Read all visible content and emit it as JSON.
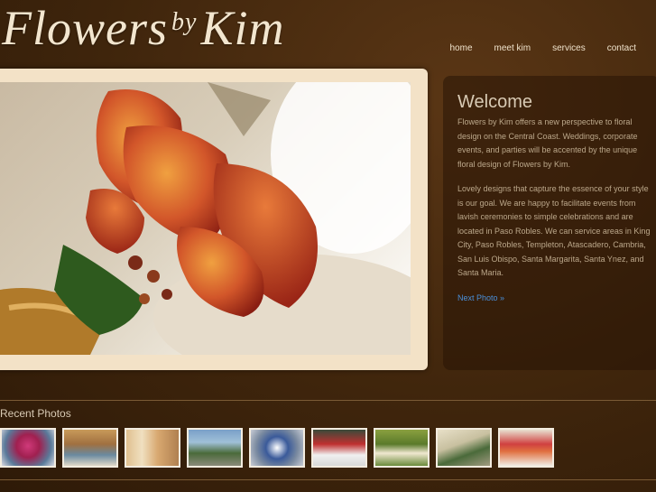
{
  "header": {
    "logo_main": "Flowers",
    "logo_by": "by",
    "logo_name": "Kim",
    "nav": [
      "home",
      "meet kim",
      "services",
      "contact"
    ]
  },
  "welcome": {
    "title": "Welcome",
    "para1": "Flowers by Kim offers a new perspective to floral design on the Central Coast. Weddings, corporate events, and parties will be accented by the unique floral design of Flowers by Kim.",
    "para2": "Lovely designs that capture the essence of your style is our goal.  We are happy to facilitate events from lavish ceremonies to simple celebrations and are located in Paso Robles.  We can service areas in King City, Paso Robles, Templeton, Atascadero, Cambria, San Luis Obispo, Santa Margarita, Santa Ynez, and Santa Maria.",
    "next_link": "Next Photo »"
  },
  "recent": {
    "title": "Recent Photos"
  }
}
